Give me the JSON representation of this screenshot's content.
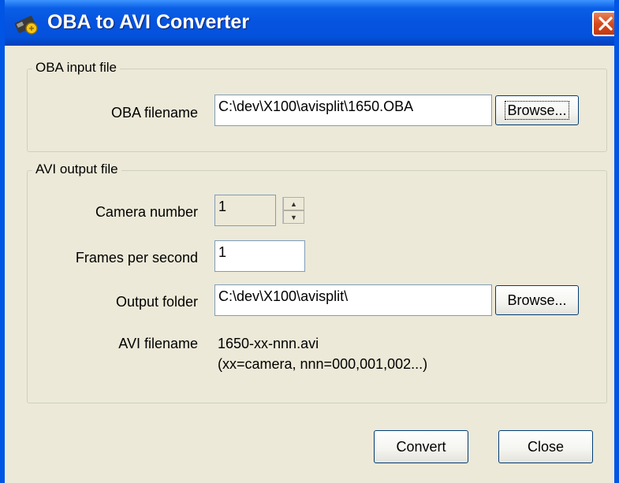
{
  "window": {
    "title": "OBA to AVI Converter"
  },
  "input_group": {
    "legend": "OBA input file",
    "oba_filename_label": "OBA filename",
    "oba_filename_value": "C:\\dev\\X100\\avisplit\\1650.OBA",
    "browse_label": "Browse..."
  },
  "output_group": {
    "legend": "AVI output file",
    "camera_number_label": "Camera number",
    "camera_number_value": "1",
    "fps_label": "Frames per second",
    "fps_value": "1",
    "output_folder_label": "Output folder",
    "output_folder_value": "C:\\dev\\X100\\avisplit\\",
    "browse_label": "Browse...",
    "avi_filename_label": "AVI filename",
    "avi_filename_value": "1650-xx-nnn.avi",
    "avi_filename_hint": "(xx=camera,  nnn=000,001,002...)"
  },
  "buttons": {
    "convert": "Convert",
    "close": "Close"
  },
  "icons": {
    "app": "oba-converter-icon",
    "close": "close-icon",
    "spin_up": "spin-up-icon",
    "spin_down": "spin-down-icon"
  },
  "colors": {
    "titlebar": "#0553df",
    "close_button": "#d64a1d",
    "dialog_background": "#ece9d8",
    "window_border": "#0055e5"
  }
}
